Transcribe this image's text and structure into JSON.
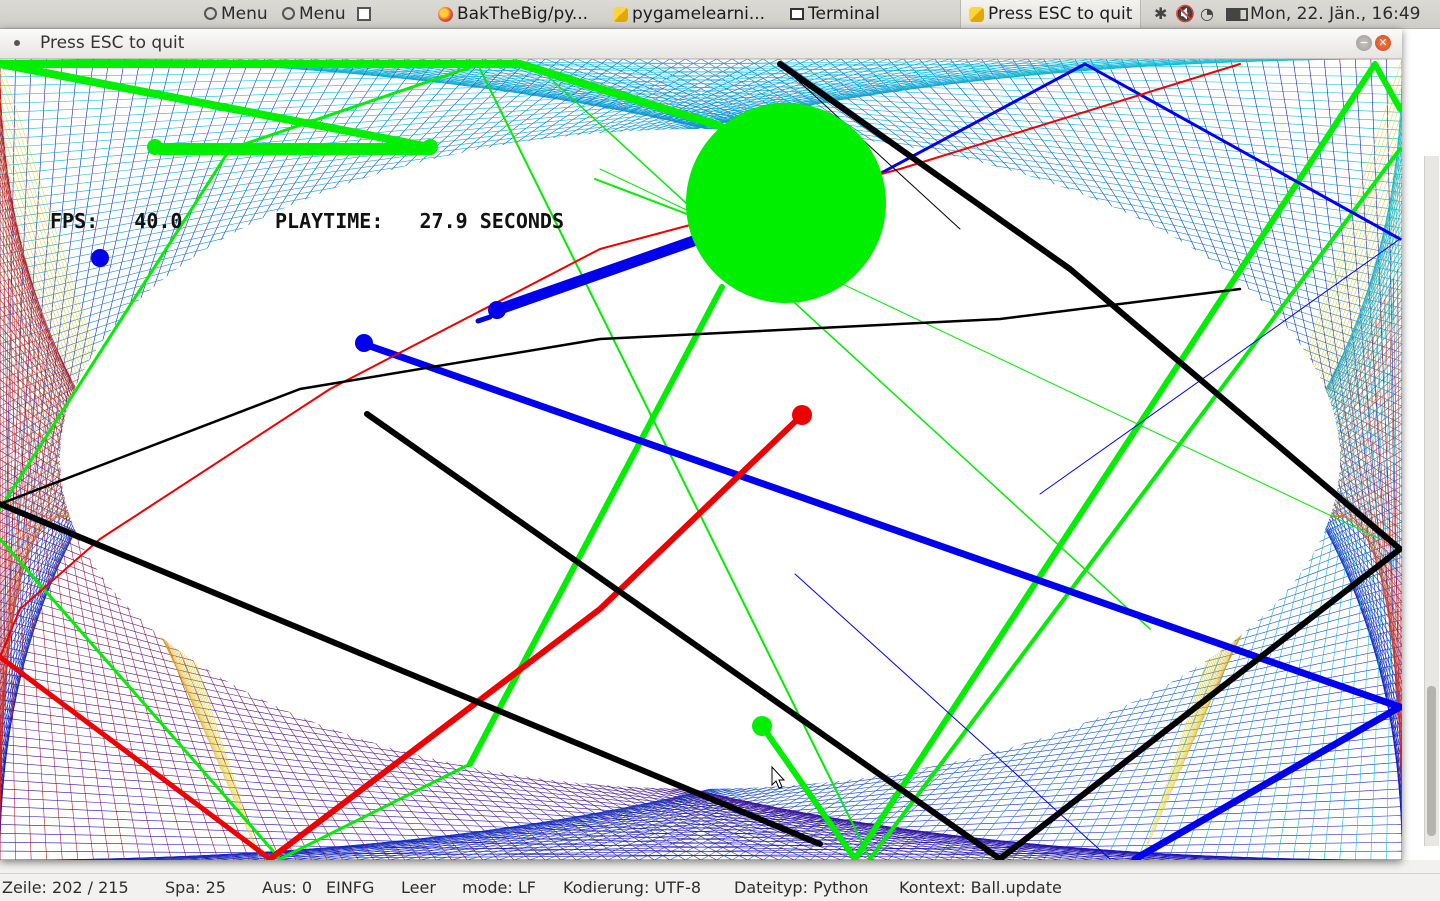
{
  "top_panel": {
    "menu1": "Menu",
    "menu2": "Menu",
    "tasks": {
      "browser": "BakTheBig/py...",
      "pygame": "pygamelearni...",
      "terminal": "Terminal",
      "game": "Press ESC to quit"
    },
    "clock": "Mon, 22. Jän., 16:49"
  },
  "window": {
    "title": "Press ESC to quit"
  },
  "hud": {
    "fps_label": "FPS:",
    "fps_value": "40.0",
    "playtime_label": "PLAYTIME:",
    "playtime_value": "27.9 SECONDS"
  },
  "statusbar": {
    "line": "Zeile: 202 / 215",
    "column": "Spa: 25",
    "selection": "Aus: 0",
    "insert_mode": "EINFG",
    "indent": "Leer",
    "line_ending": "mode: LF",
    "encoding": "Kodierung: UTF-8",
    "filetype": "Dateityp: Python",
    "context": "Kontext: Ball.update"
  },
  "colors": {
    "green": "#00ee00",
    "blue": "#0000ee",
    "red": "#ee0000",
    "black": "#000000",
    "yellow": "#e8d800"
  }
}
